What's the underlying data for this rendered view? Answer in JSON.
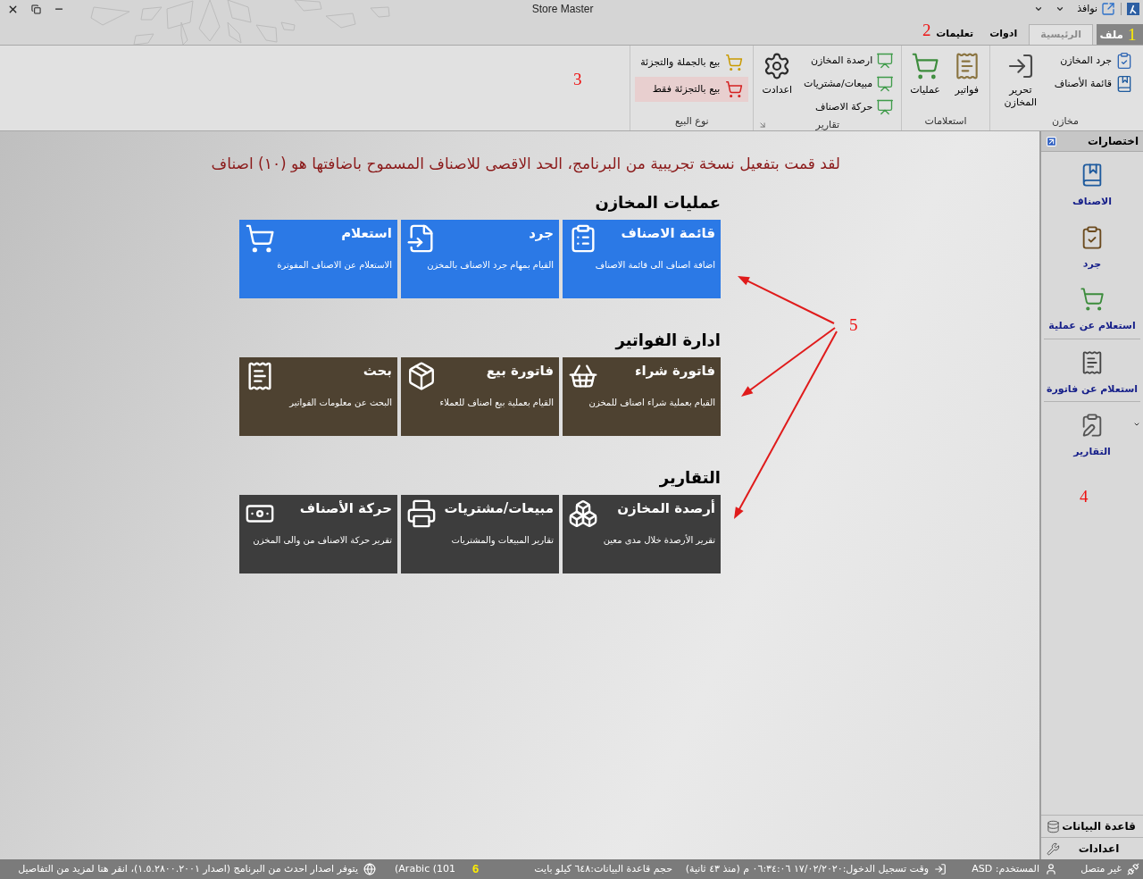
{
  "window": {
    "title": "Store Master"
  },
  "quick_access": {
    "windows_menu": "نوافذ"
  },
  "ribbon": {
    "tabs": [
      {
        "label": "ملف",
        "kind": "file",
        "selected": false
      },
      {
        "label": "الرئيسية",
        "kind": "tab",
        "selected": true
      },
      {
        "label": "ادوات",
        "kind": "tab",
        "selected": false
      },
      {
        "label": "تعليمات",
        "kind": "tab",
        "selected": false
      }
    ],
    "groups": [
      {
        "label": "مخازن",
        "dialog_launcher": false,
        "items": [
          {
            "kind": "small",
            "label": "جرد المخازن"
          },
          {
            "kind": "small",
            "label": "قائمة الأصناف"
          },
          {
            "kind": "large",
            "label": "تحرير المخازن"
          }
        ]
      },
      {
        "label": "استعلامات",
        "dialog_launcher": false,
        "items": [
          {
            "kind": "large",
            "label": "فواتير"
          },
          {
            "kind": "large",
            "label": "عمليات"
          }
        ]
      },
      {
        "label": "تقارير",
        "dialog_launcher": true,
        "items": [
          {
            "kind": "small",
            "label": "ارصدة المخازن"
          },
          {
            "kind": "small",
            "label": "مبيعات/مشتريات"
          },
          {
            "kind": "small",
            "label": "حركة الاصناف"
          },
          {
            "kind": "large",
            "label": "اعدادت"
          }
        ]
      },
      {
        "label": "نوع البيع",
        "dialog_launcher": false,
        "items": [
          {
            "kind": "option",
            "label": "بيع بالجملة والتجزئة",
            "selected": false
          },
          {
            "kind": "option",
            "label": "بيع بالتجزئة فقط",
            "selected": true
          }
        ]
      }
    ]
  },
  "main": {
    "notice": "لقد قمت بتفعيل نسخة تجريبية من البرنامج، الحد الاقصى للاصناف المسموح باضافتها هو (١٠) اصناف",
    "sections": [
      {
        "title": "عمليات المخازن",
        "color": "#2b79e6",
        "tiles": [
          {
            "title": "قائمة الاصناف",
            "description": "اضافة اصناف الى قائمة الاصناف"
          },
          {
            "title": "جرد",
            "description": "القيام بمهام جرد الاصناف بالمخزن"
          },
          {
            "title": "استعلام",
            "description": "الاستعلام عن الاصناف المفوترة"
          }
        ]
      },
      {
        "title": "ادارة الفواتير",
        "color": "#4e4231",
        "tiles": [
          {
            "title": "فاتورة شراء",
            "description": "القيام بعملية شراء اصناف للمخزن"
          },
          {
            "title": "فاتورة بيع",
            "description": "القيام بعملية بيع اصناف للعملاء"
          },
          {
            "title": "بحث",
            "description": "البحث عن معلومات الفواتير"
          }
        ]
      },
      {
        "title": "التقارير",
        "color": "#3d3d3d",
        "tiles": [
          {
            "title": "أرصدة المخازن",
            "description": "تقرير الأرصدة خلال مدى معين"
          },
          {
            "title": "مبيعات/مشتريات",
            "description": "تقارير المبيعات والمشتريات"
          },
          {
            "title": "حركة الأصناف",
            "description": "تقرير حركة الاصناف من والى المخزن"
          }
        ]
      }
    ]
  },
  "sidebar": {
    "title": "اختصارات",
    "groups": [
      {
        "items": [
          {
            "label": "الاصناف",
            "dropdown": false
          },
          {
            "label": "جرد",
            "dropdown": false
          },
          {
            "label": "استعلام عن عملية",
            "dropdown": false
          }
        ]
      },
      {
        "items": [
          {
            "label": "استعلام عن فاتورة",
            "dropdown": false
          }
        ]
      },
      {
        "items": [
          {
            "label": "التقارير",
            "dropdown": true
          }
        ]
      }
    ],
    "footer": [
      {
        "label": "قاعدة البيانات"
      },
      {
        "label": "اعدادات"
      }
    ]
  },
  "status_bar": {
    "items": [
      {
        "kind": "connection",
        "text": "غير متصل"
      },
      {
        "kind": "user",
        "text": "المستخدم: ASD"
      },
      {
        "kind": "login_time",
        "text": "وقت تسجيل الدخول:١٧/٠٢/٢٠٢٠ ٠٦:٣٤:٠٦ م (منذ ٤٣ ثانية)"
      },
      {
        "kind": "db_size",
        "text": "حجم قاعدة البيانات:٦٤٨ كيلو بايت"
      },
      {
        "kind": "keyboard",
        "text": "(Arabic (101"
      },
      {
        "kind": "update",
        "text": "يتوفر اصدار احدث من البرنامج (اصدار ١.٥.٢٨٠٠.٢٠٠١)، انقر هنا لمزيد من التفاصيل"
      }
    ]
  },
  "annotations": [
    {
      "label": "1",
      "color": "#ffee00"
    },
    {
      "label": "2",
      "color": "#ee1111"
    },
    {
      "label": "3",
      "color": "#ee1111"
    },
    {
      "label": "4",
      "color": "#ee1111"
    },
    {
      "label": "5",
      "color": "#ee1111"
    },
    {
      "label": "6",
      "color": "#ffee00"
    }
  ]
}
